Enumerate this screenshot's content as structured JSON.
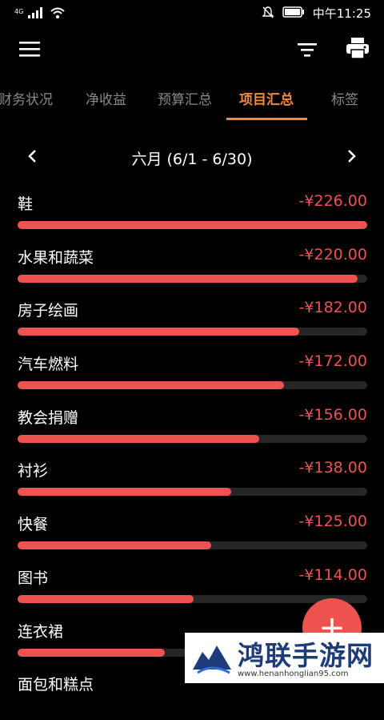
{
  "status_bar": {
    "network": "4G",
    "time": "中午11:25"
  },
  "toolbar": {
    "menu_icon": "hamburger-menu-icon",
    "filter_icon": "filter-icon",
    "print_icon": "printer-icon"
  },
  "tabs": [
    {
      "label": "财务状况"
    },
    {
      "label": "净收益"
    },
    {
      "label": "预算汇总"
    },
    {
      "label": "项目汇总",
      "active": true
    },
    {
      "label": "标签"
    }
  ],
  "period": {
    "label": "六月 (6/1 - 6/30)"
  },
  "items": [
    {
      "name": "鞋",
      "amount": "-¥226.00",
      "ratio": 1.0
    },
    {
      "name": "水果和蔬菜",
      "amount": "-¥220.00",
      "ratio": 0.973
    },
    {
      "name": "房子绘画",
      "amount": "-¥182.00",
      "ratio": 0.805
    },
    {
      "name": "汽车燃料",
      "amount": "-¥172.00",
      "ratio": 0.761
    },
    {
      "name": "教会捐赠",
      "amount": "-¥156.00",
      "ratio": 0.69
    },
    {
      "name": "衬衫",
      "amount": "-¥138.00",
      "ratio": 0.61
    },
    {
      "name": "快餐",
      "amount": "-¥125.00",
      "ratio": 0.553
    },
    {
      "name": "图书",
      "amount": "-¥114.00",
      "ratio": 0.504
    },
    {
      "name": "连衣裙",
      "amount": "",
      "ratio": 0.42
    },
    {
      "name": "面包和糕点",
      "amount": "",
      "ratio": 0.35
    }
  ],
  "fab": {
    "symbol": "+"
  },
  "watermark": {
    "title": "鸿联手游网",
    "url": "www.henanhonglian95.com"
  },
  "colors": {
    "accent": "#f08a3c",
    "bar": "#ef5350",
    "track": "#262626",
    "background": "#000000"
  }
}
